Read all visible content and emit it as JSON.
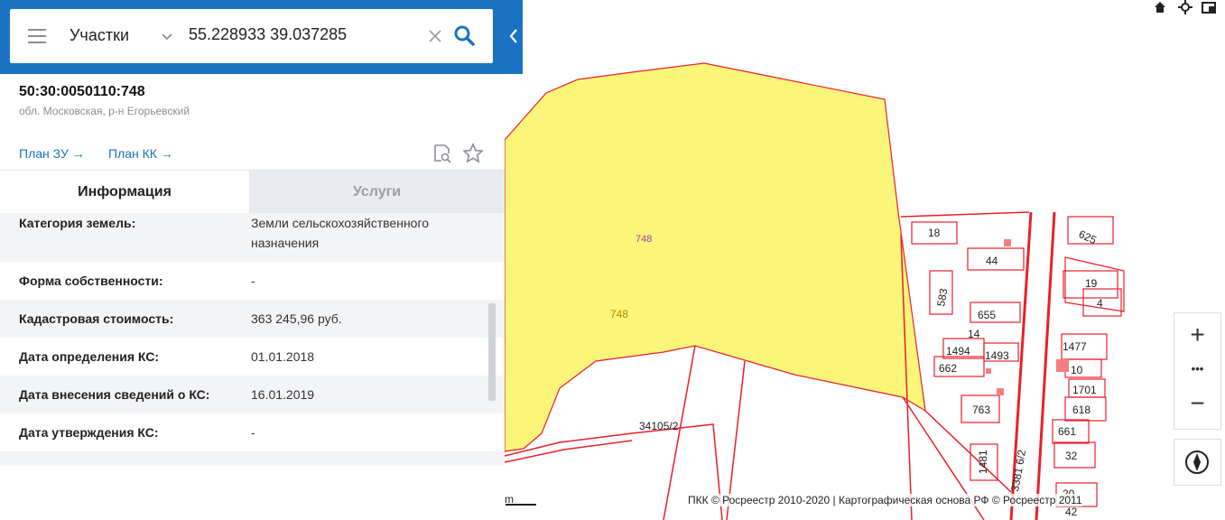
{
  "search": {
    "scope": "Участки",
    "query": "55.228933 39.037285"
  },
  "parcel": {
    "cadastral_number": "50:30:0050110:748",
    "address": "обл. Московская, р-н Егорьевский",
    "plan_zu": "План ЗУ",
    "plan_kk": "План КК",
    "arrow": "→"
  },
  "tabs": {
    "info": "Информация",
    "services": "Услуги"
  },
  "info_rows": [
    {
      "label": "Категория земель:",
      "value": "Земли сельскохозяйственного назначения"
    },
    {
      "label": "Форма собственности:",
      "value": "-"
    },
    {
      "label": "Кадастровая стоимость:",
      "value": "363 245,96 руб."
    },
    {
      "label": "Дата определения КС:",
      "value": "01.01.2018"
    },
    {
      "label": "Дата внесения сведений о КС:",
      "value": "16.01.2019"
    },
    {
      "label": "Дата утверждения КС:",
      "value": "-"
    }
  ],
  "map": {
    "labels": {
      "parcel_main": "748",
      "parcel_main_alt": "748",
      "neighbor": "34105/2",
      "road": "3381 6/2",
      "lots": [
        "18",
        "625",
        "44",
        "583",
        "19",
        "655",
        "4",
        "14",
        "1494",
        "1493",
        "1477",
        "662",
        "10",
        "1701",
        "763",
        "618",
        "661",
        "1481",
        "32",
        "20",
        "42"
      ]
    },
    "colors": {
      "parcel_fill": "#fbf67a",
      "boundary": "#e8202a",
      "accent": "#1a73c2"
    },
    "scale_unit": "m",
    "attribution": "ПКК © Росреестр 2010-2020 | Картографическая основа РФ © Росреестр 2011"
  },
  "controls": {
    "zoom_in": "+",
    "more": "•••",
    "zoom_out": "−"
  },
  "icons": {
    "menu": "hamburger-icon",
    "search": "search-icon",
    "clear": "close-icon",
    "collapse": "chevron-left-icon",
    "plan_search": "document-search-icon",
    "favorite": "star-icon",
    "compass": "compass-icon",
    "home": "home-icon",
    "locate": "locate-icon",
    "layers": "layers-icon"
  }
}
